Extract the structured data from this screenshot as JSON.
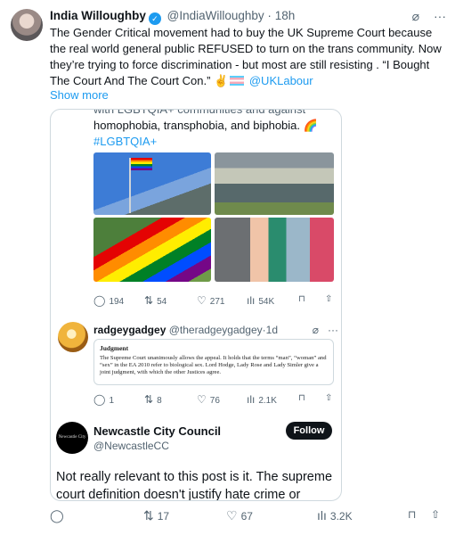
{
  "tweet": {
    "author_name": "India Willoughby",
    "handle": "@IndiaWilloughby",
    "separator": "·",
    "time": "18h",
    "text_main": "The Gender Critical movement had to buy the UK Supreme Court because the real world general public REFUSED to turn on the trans community. Now they’re trying to force discrimination - but most are still resisting . “I Bought The Court And The Court Con.”",
    "emoji_hand": "✌️",
    "mention": "@UKLabour",
    "show_more": "Show more",
    "stats": {
      "replies": "",
      "retweets": "17",
      "likes": "67",
      "views": "3.2K"
    }
  },
  "screenshot": {
    "cut_line": "with LGBTQIA+ communities and against",
    "text_line1": "homophobia, transphobia, and biphobia.",
    "rainbow_emoji": "🌈",
    "hashtag": "#LGBTQIA+",
    "stats": {
      "replies": "194",
      "retweets": "54",
      "likes": "271",
      "views": "54K"
    },
    "reply": {
      "name": "radgeygadgey",
      "handle": "@theradgeygadgey",
      "separator": "·",
      "time": "1d",
      "judgment_title": "Judgment",
      "judgment_text": "The Supreme Court unanimously allows the appeal. It holds that the terms “man”, “woman” and “sex” in the EA 2010 refer to biological sex. Lord Hodge, Lady Rose and Lady Simler give a joint judgment, with which the other Justices agree.",
      "stats": {
        "replies": "1",
        "retweets": "8",
        "likes": "76",
        "views": "2.1K"
      }
    },
    "council": {
      "avatar_text": "Newcastle City",
      "name": "Newcastle City Council",
      "handle": "@NewcastleCC",
      "follow_label": "Follow",
      "text": "Not really relevant to this post is it. The supreme court definition doesn't justify hate crime or"
    }
  },
  "icons": {
    "verified": "✓",
    "grok": "⌀",
    "more": "···",
    "reply": "◯",
    "retweet": "⇅",
    "like": "♡",
    "views": "ılı",
    "bookmark": "⊓",
    "share": "⇧"
  },
  "colors": {
    "accent": "#1d9bf0",
    "text": "#0f1419",
    "muted": "#536471",
    "border": "#cfd9de"
  }
}
